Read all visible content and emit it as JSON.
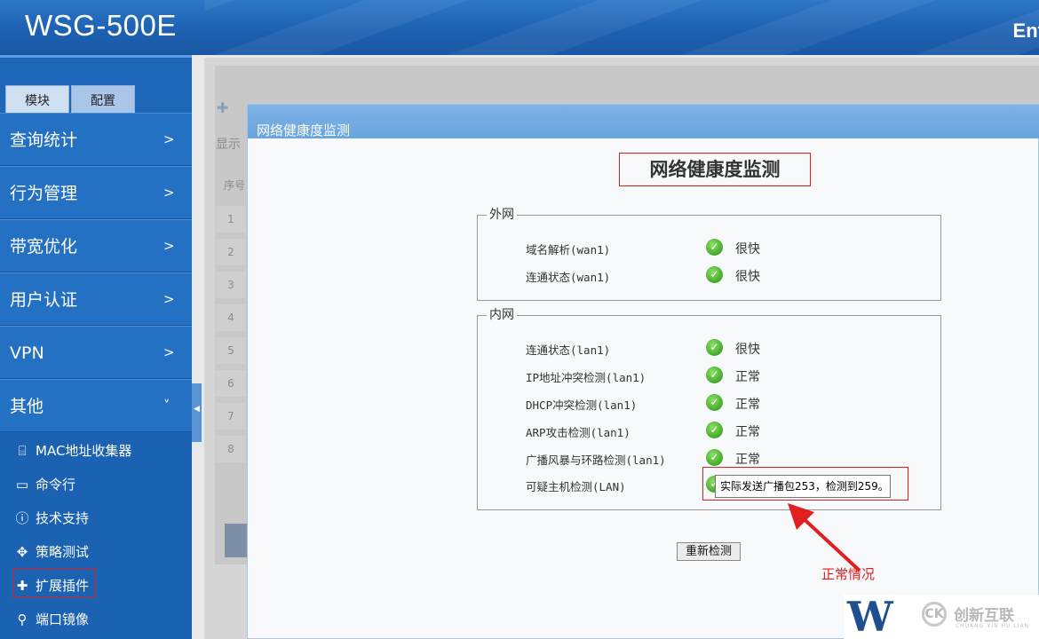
{
  "header": {
    "product": "WSG-500E",
    "brand_cut": "Ent"
  },
  "sidebar": {
    "tabs": [
      "模块",
      "配置"
    ],
    "menus": [
      {
        "label": "查询统计",
        "chevron": ">"
      },
      {
        "label": "行为管理",
        "chevron": ">"
      },
      {
        "label": "带宽优化",
        "chevron": ">"
      },
      {
        "label": "用户认证",
        "chevron": ">"
      },
      {
        "label": "VPN",
        "chevron": ">"
      },
      {
        "label": "其他",
        "chevron": "˅"
      }
    ],
    "submenu": [
      {
        "label": "MAC地址收集器",
        "icon": "device-icon"
      },
      {
        "label": "命令行",
        "icon": "terminal-icon"
      },
      {
        "label": "技术支持",
        "icon": "help-icon"
      },
      {
        "label": "策略测试",
        "icon": "move-icon"
      },
      {
        "label": "扩展插件",
        "icon": "puzzle-icon"
      },
      {
        "label": "端口镜像",
        "icon": "mirror-icon"
      }
    ]
  },
  "background_page": {
    "show_label": "显示",
    "seq_header": "序号",
    "rows": [
      "1",
      "2",
      "3",
      "4",
      "5",
      "6",
      "7",
      "8"
    ]
  },
  "dialog": {
    "title": "网络健康度监测",
    "heading": "网络健康度监测",
    "wan": {
      "legend": "外网",
      "rows": [
        {
          "label": "域名解析(wan1)",
          "value": "很快"
        },
        {
          "label": "连通状态(wan1)",
          "value": "很快"
        }
      ]
    },
    "lan": {
      "legend": "内网",
      "rows": [
        {
          "label": "连通状态(lan1)",
          "value": "很快"
        },
        {
          "label": "IP地址冲突检测(lan1)",
          "value": "正常"
        },
        {
          "label": "DHCP冲突检测(lan1)",
          "value": "正常"
        },
        {
          "label": "ARP攻击检测(lan1)",
          "value": "正常"
        },
        {
          "label": "广播风暴与环路检测(lan1)",
          "value": "正常"
        },
        {
          "label": "可疑主机检测(LAN)",
          "value": ""
        }
      ]
    },
    "tooltip": "实际发送广播包253，检测到259。",
    "recheck_button": "重新检测"
  },
  "annotation": {
    "note": "正常情况",
    "color": "#e02020"
  },
  "watermark": {
    "letter": "W",
    "circle": "CK",
    "text": "创新互联",
    "sub": "CHUANG XIN HU LIAN"
  }
}
